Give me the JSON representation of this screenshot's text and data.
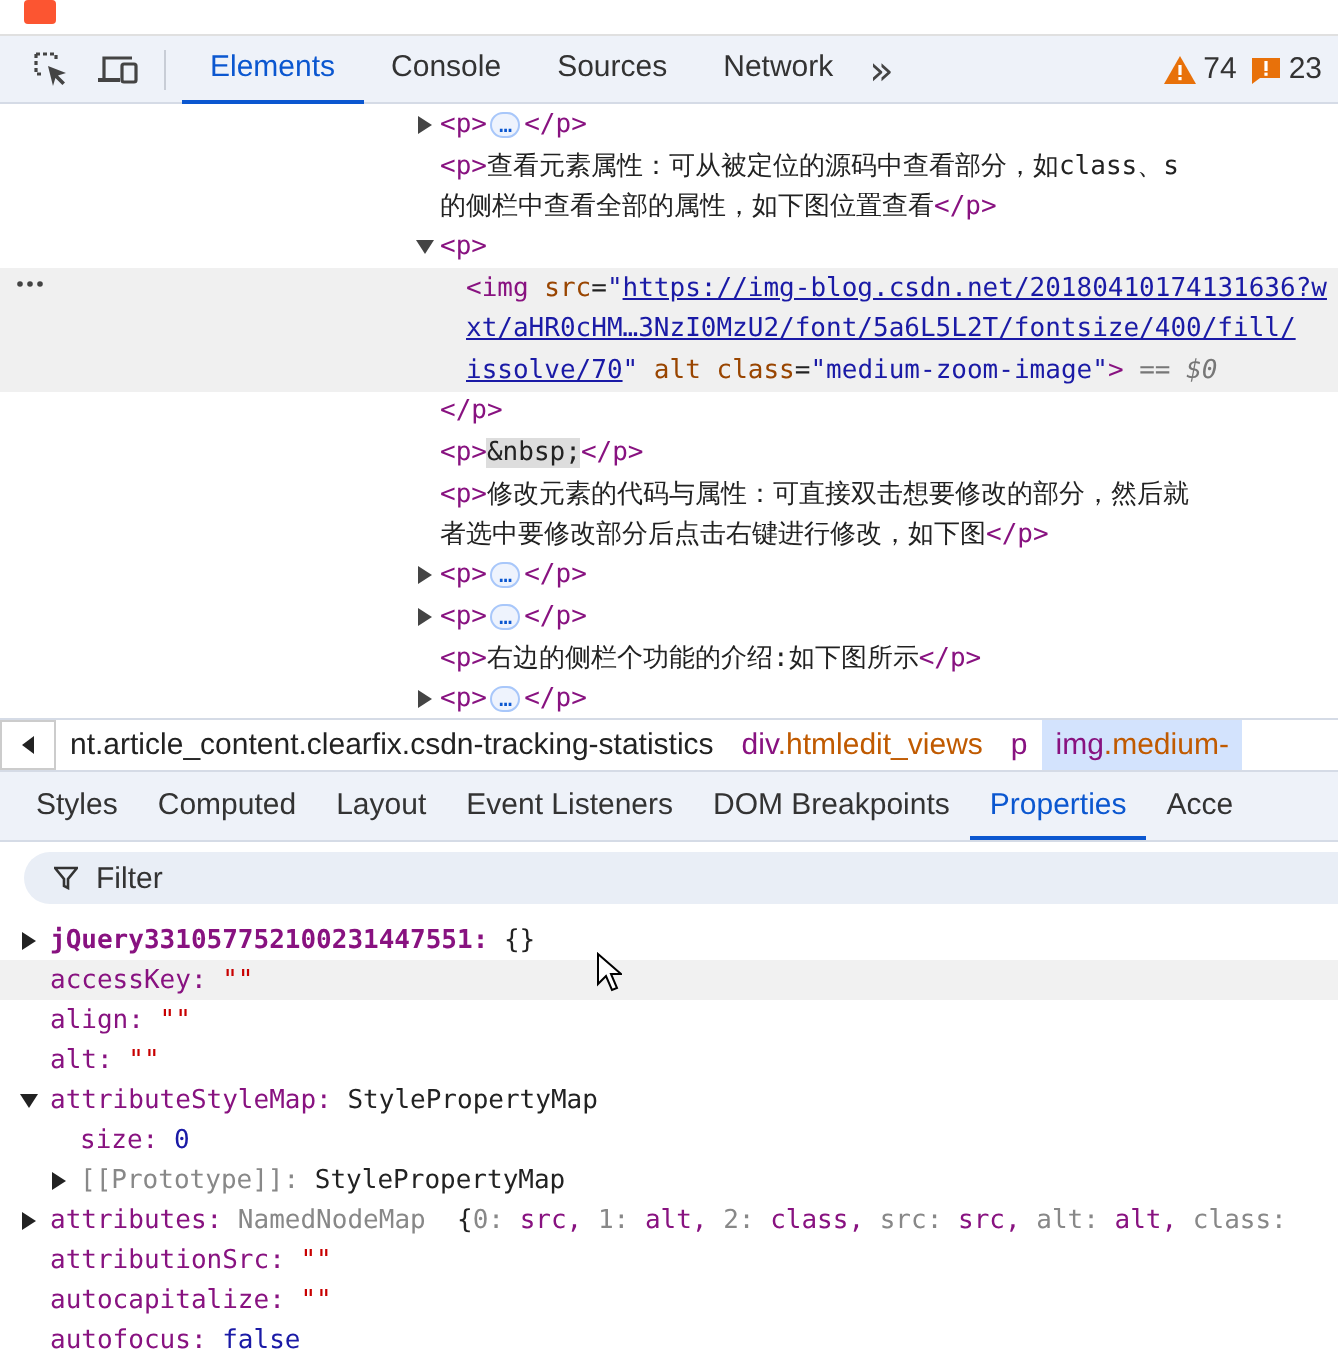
{
  "toolbar": {
    "tabs": [
      {
        "label": "Elements",
        "selected": true
      },
      {
        "label": "Console",
        "selected": false
      },
      {
        "label": "Sources",
        "selected": false
      },
      {
        "label": "Network",
        "selected": false
      }
    ],
    "more": "»",
    "warnings": "74",
    "errors": "23"
  },
  "dom": {
    "nodes": [
      {
        "selected": false,
        "expanded": false,
        "lines": [
          [
            {
              "kind": "tag",
              "text": "<p>"
            },
            {
              "kind": "badge",
              "text": "…"
            },
            {
              "kind": "tag",
              "text": "</p>"
            }
          ]
        ]
      },
      {
        "selected": false,
        "lines": [
          [
            {
              "kind": "tag",
              "text": "<p>"
            },
            {
              "kind": "plain",
              "text": "查看元素属性：可从被定位的源码中查看部分，如class、s"
            }
          ],
          [
            {
              "kind": "plain",
              "text": "的侧栏中查看全部的属性，如下图位置查看"
            },
            {
              "kind": "tag",
              "text": "</p>"
            }
          ]
        ]
      },
      {
        "selected": false,
        "expanded": true,
        "lines": [
          [
            {
              "kind": "tag",
              "text": "<p>"
            }
          ]
        ],
        "children": [
          {
            "selected": true,
            "lines": [
              [
                {
                  "kind": "tag",
                  "text": "<img"
                },
                {
                  "kind": "attr",
                  "text": " src"
                },
                {
                  "kind": "plain",
                  "text": "="
                },
                {
                  "kind": "val",
                  "text": "\""
                },
                {
                  "kind": "link",
                  "text": "https://img-blog.csdn.net/20180410174131636?w"
                }
              ],
              [
                {
                  "kind": "link",
                  "text": "xt/aHR0cHM…3NzI0MzU2/font/5a6L5L2T/fontsize/400/fill/"
                }
              ],
              [
                {
                  "kind": "link",
                  "text": "issolve/70"
                },
                {
                  "kind": "val",
                  "text": "\""
                },
                {
                  "kind": "attr",
                  "text": " alt class"
                },
                {
                  "kind": "plain",
                  "text": "="
                },
                {
                  "kind": "val",
                  "text": "\"medium-zoom-image\""
                },
                {
                  "kind": "tag",
                  "text": ">"
                },
                {
                  "kind": "ref",
                  "text": " == $0"
                }
              ]
            ]
          }
        ],
        "closing": [
          [
            {
              "kind": "tag",
              "text": "</p>"
            }
          ]
        ]
      },
      {
        "selected": false,
        "lines": [
          [
            {
              "kind": "tag",
              "text": "<p>"
            },
            {
              "kind": "entity",
              "text": "&nbsp;"
            },
            {
              "kind": "tag",
              "text": "</p>"
            }
          ]
        ]
      },
      {
        "selected": false,
        "lines": [
          [
            {
              "kind": "tag",
              "text": "<p>"
            },
            {
              "kind": "plain",
              "text": "修改元素的代码与属性：可直接双击想要修改的部分，然后就"
            }
          ],
          [
            {
              "kind": "plain",
              "text": "者选中要修改部分后点击右键进行修改，如下图"
            },
            {
              "kind": "tag",
              "text": "</p>"
            }
          ]
        ]
      },
      {
        "selected": false,
        "expanded": false,
        "lines": [
          [
            {
              "kind": "tag",
              "text": "<p>"
            },
            {
              "kind": "badge",
              "text": "…"
            },
            {
              "kind": "tag",
              "text": "</p>"
            }
          ]
        ]
      },
      {
        "selected": false,
        "expanded": false,
        "lines": [
          [
            {
              "kind": "tag",
              "text": "<p>"
            },
            {
              "kind": "badge",
              "text": "…"
            },
            {
              "kind": "tag",
              "text": "</p>"
            }
          ]
        ]
      },
      {
        "selected": false,
        "lines": [
          [
            {
              "kind": "tag",
              "text": "<p>"
            },
            {
              "kind": "plain",
              "text": "右边的侧栏个功能的介绍:如下图所示"
            },
            {
              "kind": "tag",
              "text": "</p>"
            }
          ]
        ]
      },
      {
        "selected": false,
        "expanded": false,
        "lines": [
          [
            {
              "kind": "tag",
              "text": "<p>"
            },
            {
              "kind": "badge",
              "text": "…"
            },
            {
              "kind": "tag",
              "text": "</p>"
            }
          ]
        ]
      }
    ]
  },
  "breadcrumbs": [
    {
      "kind": "clipped",
      "text": "nt.article_content.clearfix.csdn-tracking-statistics",
      "selected": false
    },
    {
      "kind": "node",
      "tag": "div",
      "cls": ".htmledit_views",
      "selected": false
    },
    {
      "kind": "node",
      "tag": "p",
      "selected": false
    },
    {
      "kind": "node",
      "tag": "img",
      "cls": ".medium-",
      "selected": true
    }
  ],
  "sidebar_tabs": [
    {
      "label": "Styles",
      "selected": false
    },
    {
      "label": "Computed",
      "selected": false
    },
    {
      "label": "Layout",
      "selected": false
    },
    {
      "label": "Event Listeners",
      "selected": false
    },
    {
      "label": "DOM Breakpoints",
      "selected": false
    },
    {
      "label": "Properties",
      "selected": true
    },
    {
      "label": "Acce",
      "selected": false
    }
  ],
  "filter": {
    "placeholder": "Filter"
  },
  "properties": [
    {
      "kind": "own",
      "key": "jQuery331057752100231447551:",
      "value": {
        "kind": "object",
        "text": "{}"
      },
      "expanded": false,
      "hovered": false
    },
    {
      "kind": "plain",
      "key": "accessKey:",
      "value": {
        "kind": "string",
        "text": "\"\""
      },
      "hovered": true
    },
    {
      "kind": "plain",
      "key": "align:",
      "value": {
        "kind": "string",
        "text": "\"\""
      },
      "hovered": false
    },
    {
      "kind": "plain",
      "key": "alt:",
      "value": {
        "kind": "string",
        "text": "\"\""
      },
      "hovered": false
    },
    {
      "kind": "plain",
      "key": "attributeStyleMap:",
      "value": {
        "kind": "object",
        "text": "StylePropertyMap"
      },
      "expanded": true,
      "hovered": false,
      "children": [
        {
          "kind": "plain",
          "key": "size:",
          "value": {
            "kind": "number",
            "text": "0"
          },
          "hovered": false
        },
        {
          "kind": "proto",
          "key": "[[Prototype]]:",
          "value": {
            "kind": "object",
            "text": "StylePropertyMap"
          },
          "expanded": false,
          "hovered": false
        }
      ]
    },
    {
      "kind": "plain",
      "key": "attributes:",
      "value": {
        "kind": "class",
        "text": "NamedNodeMap"
      },
      "expanded": false,
      "hovered": false,
      "preview": [
        {
          "kind": "punct",
          "text": "{"
        },
        {
          "kind": "key",
          "text": "0: "
        },
        {
          "kind": "value",
          "text": "src, "
        },
        {
          "kind": "key",
          "text": "1: "
        },
        {
          "kind": "value",
          "text": "alt, "
        },
        {
          "kind": "key",
          "text": "2: "
        },
        {
          "kind": "value",
          "text": "class, "
        },
        {
          "kind": "key",
          "text": "src: "
        },
        {
          "kind": "value",
          "text": "src, "
        },
        {
          "kind": "key",
          "text": "alt: "
        },
        {
          "kind": "value",
          "text": "alt, "
        },
        {
          "kind": "key",
          "text": "class:"
        }
      ]
    },
    {
      "kind": "plain",
      "key": "attributionSrc:",
      "value": {
        "kind": "string",
        "text": "\"\""
      },
      "hovered": false
    },
    {
      "kind": "plain",
      "key": "autocapitalize:",
      "value": {
        "kind": "string",
        "text": "\"\""
      },
      "hovered": false
    },
    {
      "kind": "plain",
      "key": "autofocus:",
      "value": {
        "kind": "boolean",
        "text": "false"
      },
      "hovered": false
    }
  ]
}
